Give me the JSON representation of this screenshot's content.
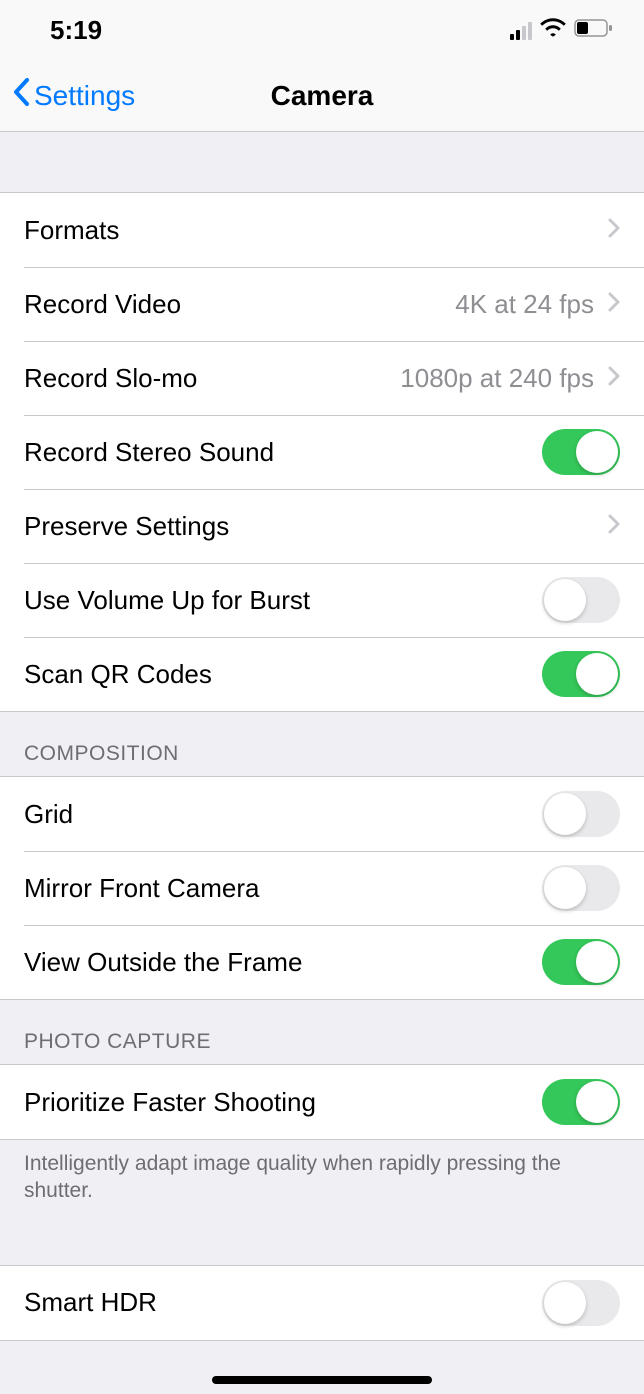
{
  "status": {
    "time": "5:19"
  },
  "nav": {
    "back": "Settings",
    "title": "Camera"
  },
  "sections": [
    {
      "header": null,
      "footer": null,
      "cells": [
        {
          "label": "Formats",
          "type": "link",
          "detail": ""
        },
        {
          "label": "Record Video",
          "type": "link",
          "detail": "4K at 24 fps"
        },
        {
          "label": "Record Slo-mo",
          "type": "link",
          "detail": "1080p at 240 fps"
        },
        {
          "label": "Record Stereo Sound",
          "type": "toggle",
          "on": true
        },
        {
          "label": "Preserve Settings",
          "type": "link",
          "detail": ""
        },
        {
          "label": "Use Volume Up for Burst",
          "type": "toggle",
          "on": false
        },
        {
          "label": "Scan QR Codes",
          "type": "toggle",
          "on": true
        }
      ]
    },
    {
      "header": "COMPOSITION",
      "footer": null,
      "cells": [
        {
          "label": "Grid",
          "type": "toggle",
          "on": false
        },
        {
          "label": "Mirror Front Camera",
          "type": "toggle",
          "on": false
        },
        {
          "label": "View Outside the Frame",
          "type": "toggle",
          "on": true
        }
      ]
    },
    {
      "header": "PHOTO CAPTURE",
      "footer": "Intelligently adapt image quality when rapidly pressing the shutter.",
      "cells": [
        {
          "label": "Prioritize Faster Shooting",
          "type": "toggle",
          "on": true
        }
      ]
    },
    {
      "header": null,
      "footer": null,
      "cells": [
        {
          "label": "Smart HDR",
          "type": "toggle",
          "on": false
        }
      ]
    }
  ]
}
